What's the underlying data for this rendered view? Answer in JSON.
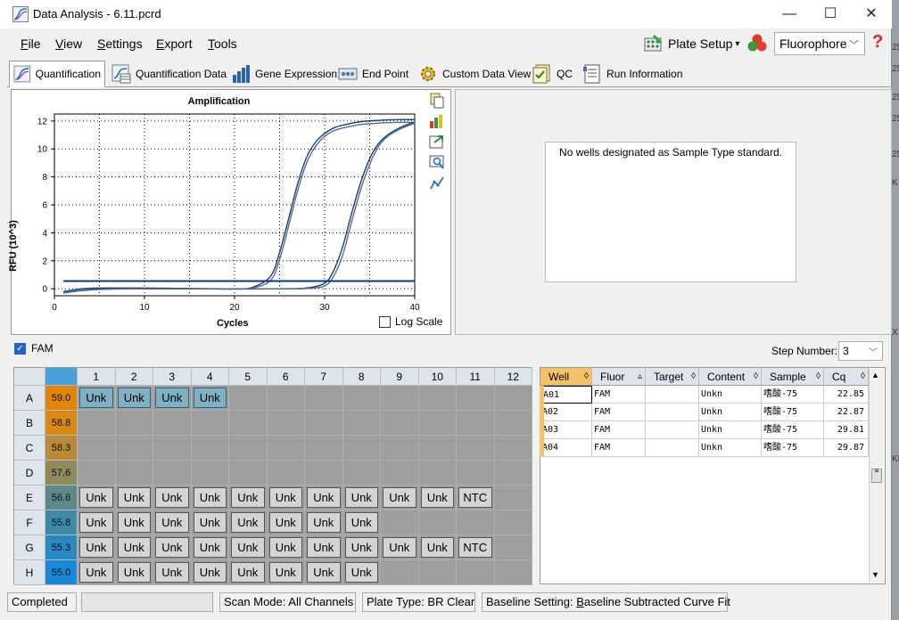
{
  "window": {
    "title": "Data Analysis - 6.11.pcrd",
    "minimize_glyph": "—",
    "maximize_glyph": "☐",
    "close_glyph": "✕"
  },
  "menu": {
    "file": "ile",
    "file_key": "F",
    "view": "iew",
    "view_key": "V",
    "settings": "ettings",
    "settings_key": "S",
    "export": "xport",
    "export_key": "E",
    "tools": "ools",
    "tools_key": "T"
  },
  "toolbar": {
    "plate_setup": "Plate Setup",
    "dropdown_glyph": "▾",
    "fluor_value": "Fluorophore",
    "help_glyph": "?"
  },
  "tabs": [
    "Quantification",
    "Quantification Data",
    "Gene Expression",
    "End Point",
    "Custom Data View",
    "QC",
    "Run Information"
  ],
  "chart_data": {
    "type": "line",
    "title": "Amplification",
    "xlabel": "Cycles",
    "ylabel": "RFU (10^3)",
    "xlim": [
      0,
      40
    ],
    "ylim": [
      -0.5,
      12.5
    ],
    "xticks": [
      0,
      10,
      20,
      30,
      40
    ],
    "yticks": [
      0,
      2,
      4,
      6,
      8,
      10,
      12
    ],
    "grid": true,
    "threshold": 0.55,
    "series": [
      {
        "color": "#1f3f6e",
        "x": [
          1,
          3,
          5,
          10,
          15,
          20,
          22,
          24,
          25,
          26,
          27,
          28,
          29,
          30,
          31,
          32,
          34,
          36,
          38,
          40
        ],
        "y": [
          -0.2,
          0.0,
          0.05,
          0.05,
          0.02,
          0.0,
          0.1,
          0.9,
          2.6,
          5.0,
          7.5,
          9.4,
          10.5,
          11.1,
          11.5,
          11.7,
          11.95,
          12.05,
          12.1,
          12.1
        ]
      },
      {
        "color": "#4d6f96",
        "x": [
          1,
          3,
          5,
          10,
          15,
          20,
          22,
          24,
          25,
          26,
          27,
          28,
          29,
          30,
          31,
          32,
          34,
          36,
          38,
          40
        ],
        "y": [
          -0.3,
          -0.05,
          0.0,
          0.0,
          0.0,
          -0.02,
          0.05,
          0.6,
          2.1,
          4.5,
          7.0,
          9.0,
          10.2,
          10.9,
          11.3,
          11.5,
          11.75,
          11.85,
          11.9,
          11.9
        ]
      },
      {
        "color": "#1f3f6e",
        "x": [
          1,
          5,
          10,
          15,
          20,
          25,
          28,
          30,
          31,
          32,
          33,
          34,
          35,
          36,
          37,
          38,
          39,
          40
        ],
        "y": [
          -0.3,
          0.0,
          0.0,
          0.0,
          -0.02,
          0.0,
          0.05,
          0.4,
          1.3,
          3.0,
          5.4,
          7.6,
          9.3,
          10.4,
          11.0,
          11.4,
          11.7,
          11.9
        ]
      },
      {
        "color": "#4d6f96",
        "x": [
          1,
          5,
          10,
          15,
          20,
          25,
          28,
          30,
          31,
          32,
          33,
          34,
          35,
          36,
          37,
          38,
          39,
          40
        ],
        "y": [
          -0.25,
          -0.05,
          0.0,
          0.0,
          0.0,
          0.0,
          0.02,
          0.2,
          0.9,
          2.4,
          4.8,
          7.1,
          8.9,
          10.2,
          10.9,
          11.3,
          11.6,
          11.85
        ]
      }
    ],
    "log_scale_label": "Log Scale",
    "log_scale_checked": false
  },
  "standard_curve": {
    "message": "No wells designated as Sample Type standard."
  },
  "fluor_filter": {
    "label": "FAM",
    "checked": true
  },
  "step": {
    "label": "Step Number:",
    "value": "3"
  },
  "plate": {
    "columns": [
      "1",
      "2",
      "3",
      "4",
      "5",
      "6",
      "7",
      "8",
      "9",
      "10",
      "11",
      "12"
    ],
    "rows": [
      {
        "label": "A",
        "temp": "59.0",
        "temp_color": "#e0840c",
        "wells": [
          "Unk",
          "Unk",
          "Unk",
          "Unk",
          "",
          "",
          "",
          "",
          "",
          "",
          "",
          ""
        ],
        "selected": [
          true,
          true,
          true,
          true,
          false,
          false,
          false,
          false,
          false,
          false,
          false,
          false
        ]
      },
      {
        "label": "B",
        "temp": "58.8",
        "temp_color": "#d98918",
        "wells": [
          "",
          "",
          "",
          "",
          "",
          "",
          "",
          "",
          "",
          "",
          "",
          ""
        ],
        "selected": []
      },
      {
        "label": "C",
        "temp": "58.3",
        "temp_color": "#b98a3a",
        "wells": [
          "",
          "",
          "",
          "",
          "",
          "",
          "",
          "",
          "",
          "",
          "",
          ""
        ],
        "selected": []
      },
      {
        "label": "D",
        "temp": "57.6",
        "temp_color": "#8f8a5e",
        "wells": [
          "",
          "",
          "",
          "",
          "",
          "",
          "",
          "",
          "",
          "",
          "",
          ""
        ],
        "selected": []
      },
      {
        "label": "E",
        "temp": "56.6",
        "temp_color": "#5d8a88",
        "wells": [
          "Unk",
          "Unk",
          "Unk",
          "Unk",
          "Unk",
          "Unk",
          "Unk",
          "Unk",
          "Unk",
          "Unk",
          "NTC",
          ""
        ],
        "selected": []
      },
      {
        "label": "F",
        "temp": "55.8",
        "temp_color": "#3d8aa8",
        "wells": [
          "Unk",
          "Unk",
          "Unk",
          "Unk",
          "Unk",
          "Unk",
          "Unk",
          "Unk",
          "",
          "",
          "",
          ""
        ],
        "selected": []
      },
      {
        "label": "G",
        "temp": "55.3",
        "temp_color": "#2a89c2",
        "wells": [
          "Unk",
          "Unk",
          "Unk",
          "Unk",
          "Unk",
          "Unk",
          "Unk",
          "Unk",
          "Unk",
          "Unk",
          "NTC",
          ""
        ],
        "selected": []
      },
      {
        "label": "H",
        "temp": "55.0",
        "temp_color": "#1a88d8",
        "wells": [
          "Unk",
          "Unk",
          "Unk",
          "Unk",
          "Unk",
          "Unk",
          "Unk",
          "Unk",
          "",
          "",
          "",
          ""
        ],
        "selected": []
      }
    ]
  },
  "well_table": {
    "headers": [
      "Well",
      "Fluor",
      "Target",
      "Content",
      "Sample",
      "Cq"
    ],
    "sort_glyphs": [
      "◊",
      "▵",
      "◊",
      "◊",
      "◊",
      "◊"
    ],
    "rows": [
      [
        "A01",
        "FAM",
        "",
        "Unkn",
        "嗜酸-75",
        "22.85"
      ],
      [
        "A02",
        "FAM",
        "",
        "Unkn",
        "嗜酸-75",
        "22.87"
      ],
      [
        "A03",
        "FAM",
        "",
        "Unkn",
        "嗜酸-75",
        "29.81"
      ],
      [
        "A04",
        "FAM",
        "",
        "Unkn",
        "嗜酸-75",
        "29.87"
      ]
    ]
  },
  "status": {
    "state": "Completed",
    "scan_mode": "Scan Mode: All Channels",
    "plate_type": "Plate Type: BR Clear",
    "baseline_prefix": "Baseline Setting: ",
    "baseline_key": "B",
    "baseline_rest": "aseline Subtracted Curve Fit"
  },
  "background_strip": [
    "25",
    "25",
    "25",
    "25",
    "25",
    "K",
    "X",
    "KI"
  ]
}
